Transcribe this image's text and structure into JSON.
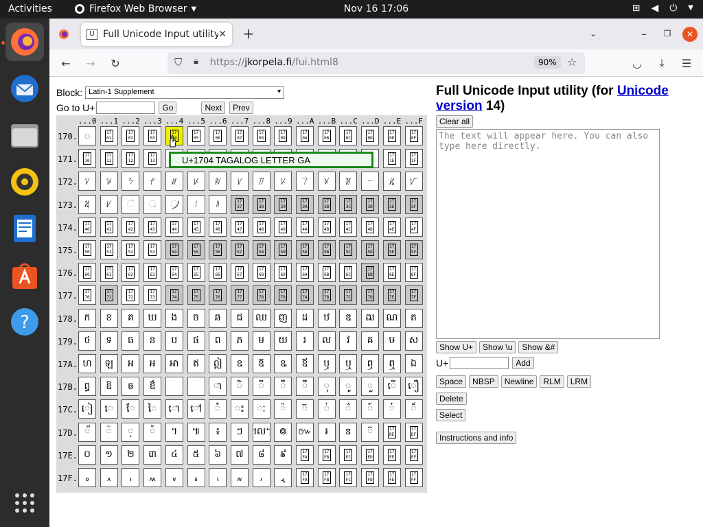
{
  "topbar": {
    "activities": "Activities",
    "app_name": "Firefox Web Browser",
    "clock": "Nov 16  17:06"
  },
  "browser": {
    "tab_title": "Full Unicode Input utility",
    "url_prefix": "https://",
    "url_domain": "jkorpela.fi",
    "url_path": "/fui.html8",
    "zoom": "90%"
  },
  "page": {
    "block_label": "Block:",
    "block_selected": "Latin-1 Supplement",
    "goto_label": "Go to U+",
    "go_button": "Go",
    "next_button": "Next",
    "prev_button": "Prev",
    "col_headers": [
      "...0",
      "...1",
      "...2",
      "...3",
      "...4",
      "...5",
      "...6",
      "...7",
      "...8",
      "...9",
      "...A",
      "...B",
      "...C",
      "...D",
      "...E",
      "...F"
    ],
    "rows": [
      {
        "label": "170.",
        "cells": [
          "◌",
          "hex:1701",
          "hex:1702",
          "hex:1703",
          "hex:1704",
          "hex:1705",
          "hex:1706",
          "hex:1707",
          "hex:1708",
          "hex:1709",
          "hex:170A",
          "hex:170B",
          "hex:170C",
          "hex:170D",
          "hex:170E",
          "hex:170F"
        ]
      },
      {
        "label": "171.",
        "cells": [
          "hex:1710",
          "hex:1711",
          "hex:1712",
          "hex:1713",
          "",
          "",
          "",
          "",
          "",
          "",
          "",
          "",
          "",
          "",
          "hex:171E",
          "hex:171F"
        ]
      },
      {
        "label": "172.",
        "cells": [
          "ᜠ",
          "ᜡ",
          "ᜢ",
          "ᜣ",
          "ᜤ",
          "ᜥ",
          "ᜦ",
          "ᜧ",
          "ᜨ",
          "ᜩ",
          "ᜪ",
          "ᜫ",
          "ᜬ",
          "ᜭ",
          "ᜮ",
          "ᜯ"
        ]
      },
      {
        "label": "173.",
        "cells": [
          "ᜰ",
          "ᜱ",
          "◌ᜲ",
          "◌ᜳ",
          "◌᜴",
          "᜵",
          "᜶",
          "u:1737",
          "u:1738",
          "u:1739",
          "u:173A",
          "u:173B",
          "u:173C",
          "u:173D",
          "u:173E",
          "u:173F"
        ]
      },
      {
        "label": "174.",
        "cells": [
          "hex:1740",
          "hex:1741",
          "hex:1742",
          "hex:1743",
          "hex:1744",
          "hex:1745",
          "hex:1746",
          "hex:1747",
          "hex:1748",
          "hex:1749",
          "hex:174A",
          "hex:174B",
          "hex:174C",
          "hex:174D",
          "hex:174E",
          "hex:174F"
        ]
      },
      {
        "label": "175.",
        "cells": [
          "hex:1750",
          "hex:1751",
          "hex:1752",
          "hex:1753",
          "u:1754",
          "u:1755",
          "u:1756",
          "u:1757",
          "u:1758",
          "u:1759",
          "u:175A",
          "u:175B",
          "u:175C",
          "u:175D",
          "u:175E",
          "u:175F"
        ]
      },
      {
        "label": "176.",
        "cells": [
          "hex:1760",
          "hex:1761",
          "hex:1762",
          "hex:1763",
          "hex:1764",
          "hex:1765",
          "hex:1766",
          "hex:1767",
          "hex:1768",
          "hex:1769",
          "hex:176A",
          "hex:176B",
          "hex:176C",
          "u:176D",
          "hex:176E",
          "hex:176F"
        ]
      },
      {
        "label": "177.",
        "cells": [
          "hex:1770",
          "u:1771",
          "hex:1772",
          "hex:1773",
          "u:1774",
          "u:1775",
          "u:1776",
          "u:1777",
          "u:1778",
          "u:1779",
          "u:177A",
          "u:177B",
          "u:177C",
          "u:177D",
          "u:177E",
          "u:177F"
        ]
      },
      {
        "label": "178.",
        "cells": [
          "ក",
          "ខ",
          "គ",
          "ឃ",
          "ង",
          "ច",
          "ឆ",
          "ជ",
          "ឈ",
          "ញ",
          "ដ",
          "ឋ",
          "ឌ",
          "ឍ",
          "ណ",
          "ត"
        ]
      },
      {
        "label": "179.",
        "cells": [
          "ថ",
          "ទ",
          "ធ",
          "ន",
          "ប",
          "ផ",
          "ព",
          "ភ",
          "ម",
          "យ",
          "រ",
          "ល",
          "វ",
          "ឝ",
          "ឞ",
          "ស"
        ]
      },
      {
        "label": "17A.",
        "cells": [
          "ហ",
          "ឡ",
          "អ",
          "ឣ",
          "ឤ",
          "ឥ",
          "ឦ",
          "ឧ",
          "ឨ",
          "ឩ",
          "ឪ",
          "ឫ",
          "ឬ",
          "ឭ",
          "ឮ",
          "ឯ"
        ]
      },
      {
        "label": "17B.",
        "cells": [
          "ឰ",
          "ឱ",
          "ឲ",
          "ឳ",
          "",
          "",
          "◌ា",
          "◌ិ",
          "◌ី",
          "◌ឹ",
          "◌ឺ",
          "◌ុ",
          "◌ូ",
          "◌ួ",
          "◌ើ",
          "◌ឿ"
        ]
      },
      {
        "label": "17C.",
        "cells": [
          "◌ៀ",
          "◌េ",
          "◌ែ",
          "◌ៃ",
          "◌ោ",
          "◌ៅ",
          "◌ំ",
          "◌ះ",
          "◌ៈ",
          "◌៉",
          "◌៊",
          "◌់",
          "◌៌",
          "◌៍",
          "◌៎",
          "◌៏"
        ]
      },
      {
        "label": "17D.",
        "cells": [
          "◌័",
          "◌៑",
          "◌្",
          "◌៓",
          "។",
          "៕",
          "៖",
          "ៗ",
          "៘",
          "៙",
          "៚",
          "៛",
          "ៜ",
          "◌៝",
          "hex:17DE",
          "hex:17DF"
        ]
      },
      {
        "label": "17E.",
        "cells": [
          "០",
          "១",
          "២",
          "៣",
          "៤",
          "៥",
          "៦",
          "៧",
          "៨",
          "៩",
          "hex:17EA",
          "hex:17EB",
          "hex:17EC",
          "hex:17ED",
          "hex:17EE",
          "hex:17EF"
        ]
      },
      {
        "label": "17F.",
        "cells": [
          "៰",
          "៱",
          "៲",
          "៳",
          "៴",
          "៵",
          "៶",
          "៷",
          "៸",
          "៹",
          "hex:17FA",
          "hex:17FB",
          "hex:17FC",
          "hex:17FD",
          "hex:17FE",
          "hex:17FF"
        ]
      }
    ],
    "tooltip": "U+1704 TAGALOG LETTER GA",
    "title_prefix": "Full Unicode Input utility (for ",
    "title_link": "Unicode version",
    "title_suffix": " 14)",
    "clear_all": "Clear all",
    "textarea_placeholder": "The text will appear here. You can also type here directly.",
    "show_u": "Show U+",
    "show_backslash_u": "Show \\u",
    "show_amp": "Show &#",
    "uplus_label": "U+",
    "add_button": "Add",
    "space_button": "Space",
    "nbsp_button": "NBSP",
    "newline_button": "Newline",
    "rlm_button": "RLM",
    "lrm_button": "LRM",
    "delete_button": "Delete",
    "select_button": "Select",
    "instructions_button": "Instructions and info"
  },
  "colors": {
    "accent": "#e95420",
    "tooltip_border": "#1a8a1a",
    "highlight": "#f0f000",
    "link": "#0000cc"
  }
}
